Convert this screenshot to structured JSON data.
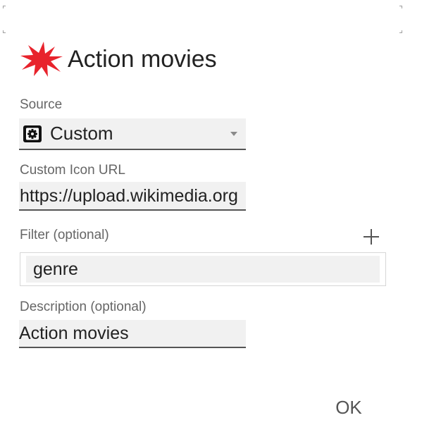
{
  "dialog": {
    "title": "Action movies",
    "title_icon": "red-starburst-icon",
    "accent_color": "#e8232c"
  },
  "source": {
    "label": "Source",
    "selected_value": "Custom",
    "selected_icon": "settings-cog-icon"
  },
  "custom_icon_url": {
    "label": "Custom Icon URL",
    "value": "https://upload.wikimedia.org"
  },
  "filter": {
    "label": "Filter (optional)",
    "add_icon": "plus-icon",
    "value": "genre"
  },
  "description": {
    "label": "Description (optional)",
    "value": "Action movies"
  },
  "actions": {
    "ok_label": "OK"
  }
}
